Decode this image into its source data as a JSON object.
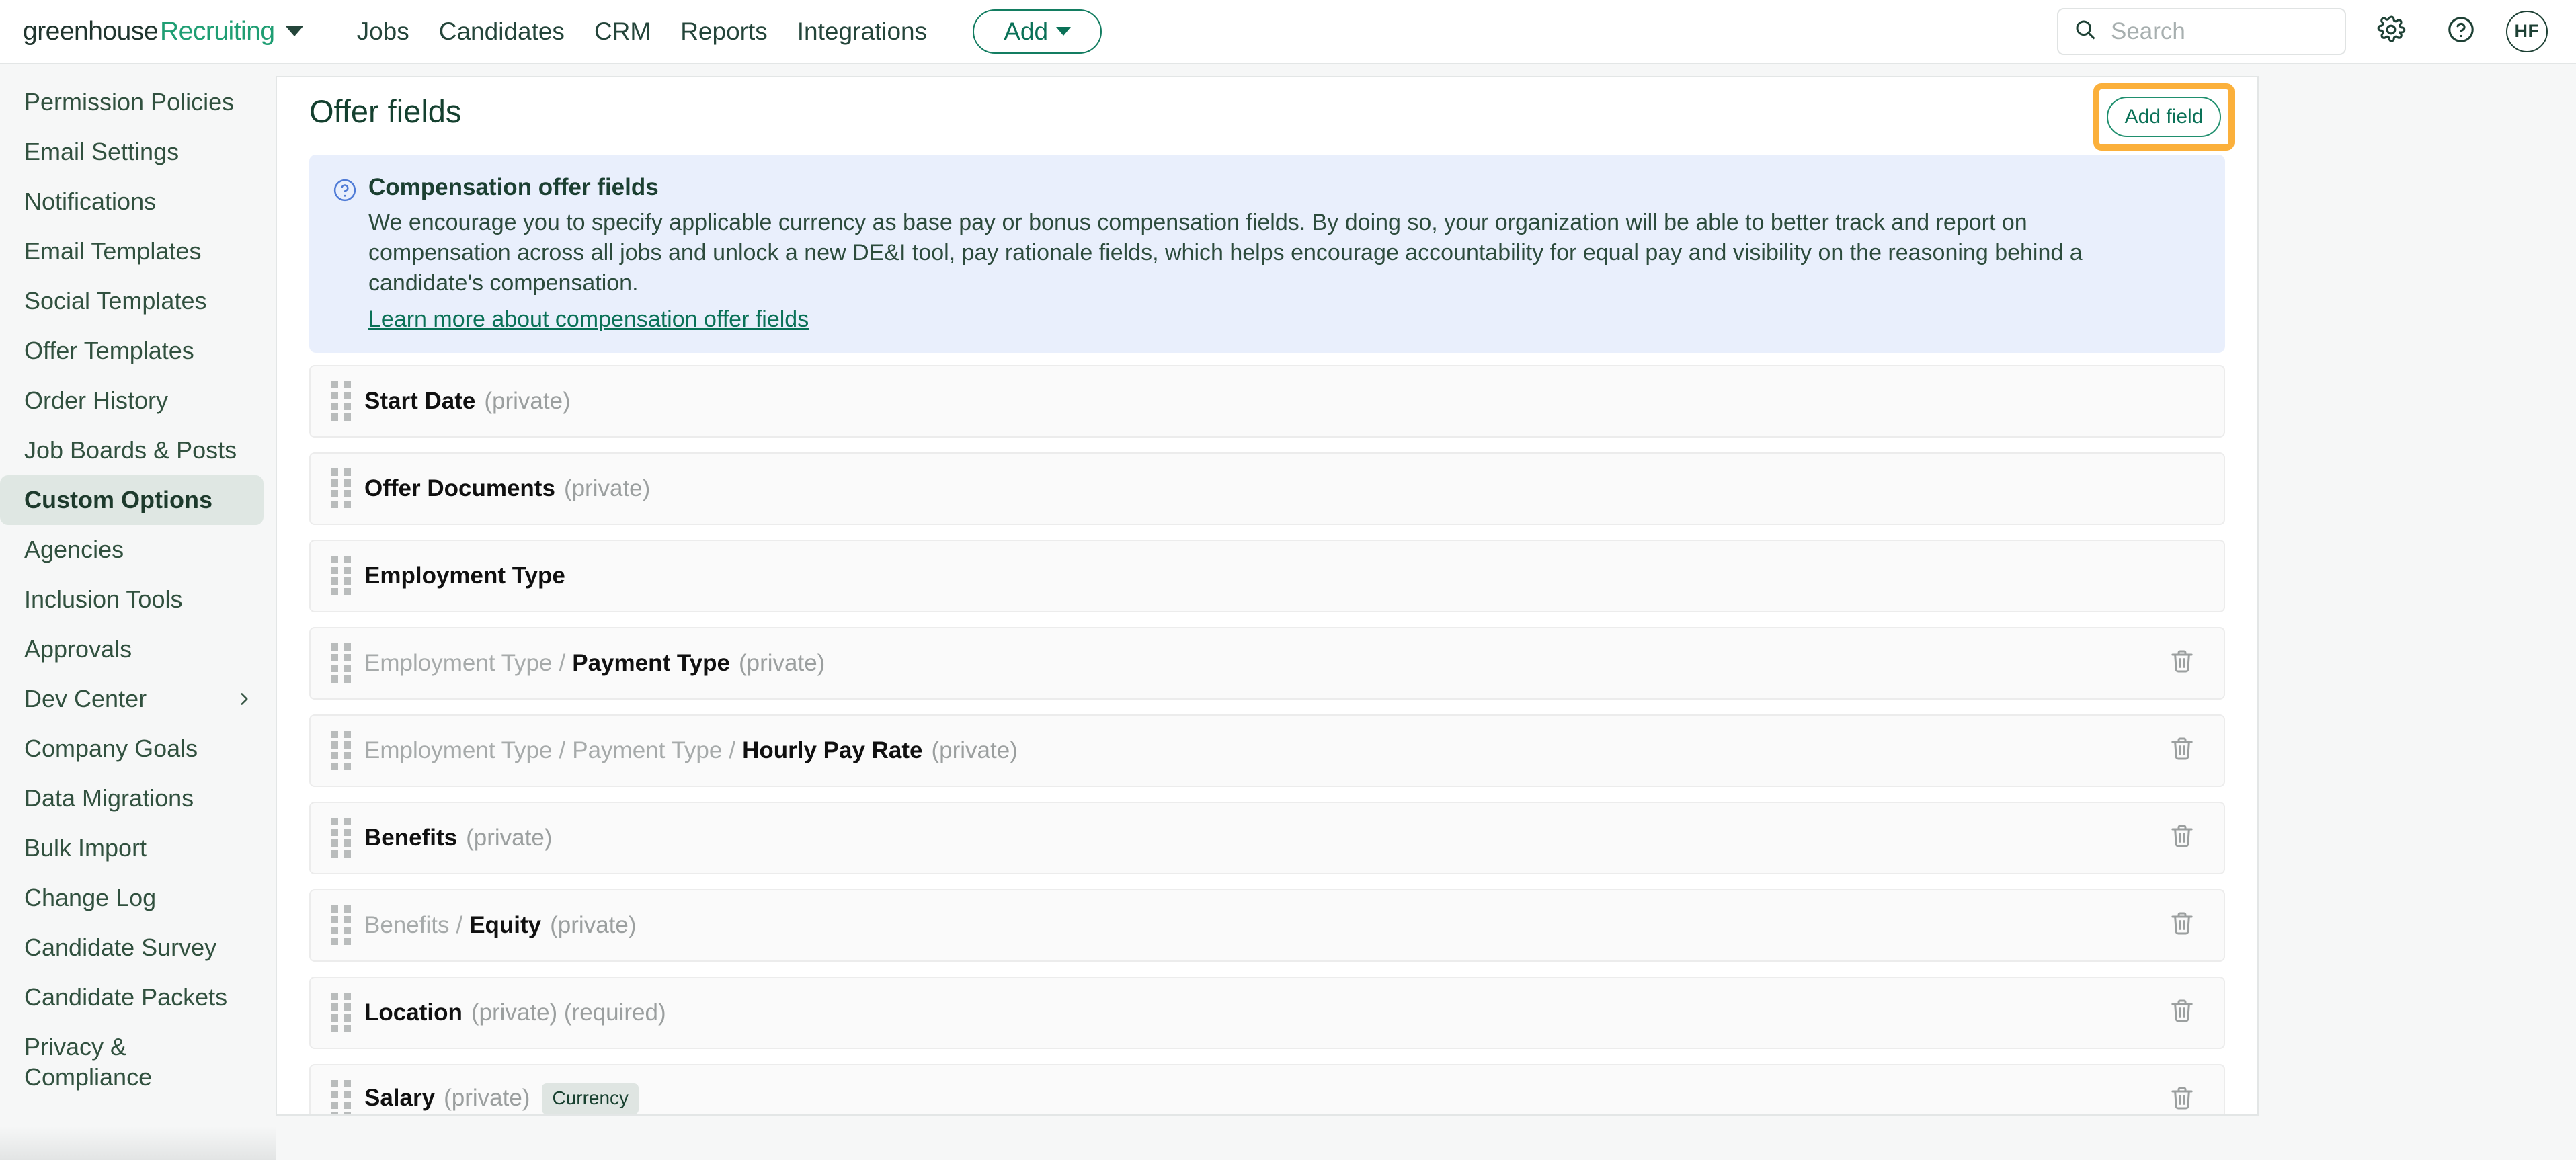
{
  "topnav": {
    "brand_primary": "greenhouse",
    "brand_secondary": "Recruiting",
    "links": [
      {
        "label": "Jobs"
      },
      {
        "label": "Candidates"
      },
      {
        "label": "CRM"
      },
      {
        "label": "Reports"
      },
      {
        "label": "Integrations"
      }
    ],
    "add_button": "Add",
    "search_placeholder": "Search",
    "avatar_initials": "HF"
  },
  "sidebar": {
    "items": [
      {
        "label": "Permission Policies",
        "active": false,
        "chevron": false
      },
      {
        "label": "Email Settings",
        "active": false,
        "chevron": false
      },
      {
        "label": "Notifications",
        "active": false,
        "chevron": false
      },
      {
        "label": "Email Templates",
        "active": false,
        "chevron": false
      },
      {
        "label": "Social Templates",
        "active": false,
        "chevron": false
      },
      {
        "label": "Offer Templates",
        "active": false,
        "chevron": false
      },
      {
        "label": "Order History",
        "active": false,
        "chevron": false
      },
      {
        "label": "Job Boards & Posts",
        "active": false,
        "chevron": false
      },
      {
        "label": "Custom Options",
        "active": true,
        "chevron": false
      },
      {
        "label": "Agencies",
        "active": false,
        "chevron": false
      },
      {
        "label": "Inclusion Tools",
        "active": false,
        "chevron": false
      },
      {
        "label": "Approvals",
        "active": false,
        "chevron": false
      },
      {
        "label": "Dev Center",
        "active": false,
        "chevron": true
      },
      {
        "label": "Company Goals",
        "active": false,
        "chevron": false
      },
      {
        "label": "Data Migrations",
        "active": false,
        "chevron": false
      },
      {
        "label": "Bulk Import",
        "active": false,
        "chevron": false
      },
      {
        "label": "Change Log",
        "active": false,
        "chevron": false
      },
      {
        "label": "Candidate Survey",
        "active": false,
        "chevron": false
      },
      {
        "label": "Candidate Packets",
        "active": false,
        "chevron": false
      },
      {
        "label": "Privacy & Compliance",
        "active": false,
        "chevron": false,
        "two_line": true
      }
    ]
  },
  "main": {
    "page_title": "Offer fields",
    "add_field_label": "Add field",
    "highlight_color": "#fbb03b",
    "banner": {
      "title": "Compensation offer fields",
      "text": "We encourage you to specify applicable currency as base pay or bonus compensation fields. By doing so, your organization will be able to better track and report on compensation across all jobs and unlock a new DE&I tool, pay rationale fields, which helps encourage accountability for equal pay and visibility on the reasoning behind a candidate's compensation.",
      "link": "Learn more about compensation offer fields",
      "background": "#e9effc",
      "icon": "question-circle-icon"
    },
    "fields": [
      {
        "crumbs": [],
        "name": "Start Date",
        "meta": "(private)",
        "badge": "",
        "deletable": false
      },
      {
        "crumbs": [],
        "name": "Offer Documents",
        "meta": "(private)",
        "badge": "",
        "deletable": false
      },
      {
        "crumbs": [],
        "name": "Employment Type",
        "meta": "",
        "badge": "",
        "deletable": false
      },
      {
        "crumbs": [
          "Employment Type"
        ],
        "name": "Payment Type",
        "meta": "(private)",
        "badge": "",
        "deletable": true
      },
      {
        "crumbs": [
          "Employment Type",
          "Payment Type"
        ],
        "name": "Hourly Pay Rate",
        "meta": "(private)",
        "badge": "",
        "deletable": true
      },
      {
        "crumbs": [],
        "name": "Benefits",
        "meta": "(private)",
        "badge": "",
        "deletable": true
      },
      {
        "crumbs": [
          "Benefits"
        ],
        "name": "Equity",
        "meta": "(private)",
        "badge": "",
        "deletable": true
      },
      {
        "crumbs": [],
        "name": "Location",
        "meta": "(private) (required)",
        "badge": "",
        "deletable": true
      },
      {
        "crumbs": [],
        "name": "Salary",
        "meta": "(private)",
        "badge": "Currency",
        "deletable": true
      }
    ]
  }
}
